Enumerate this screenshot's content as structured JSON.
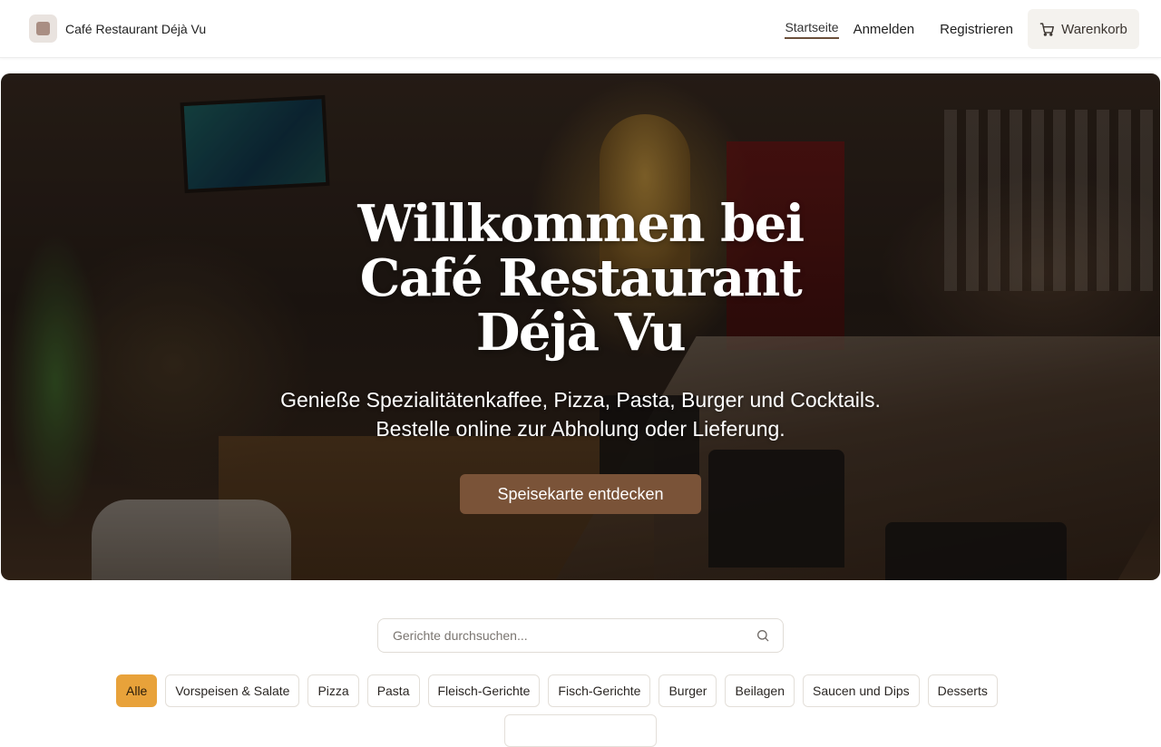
{
  "header": {
    "brand_name": "Café Restaurant Déjà Vu",
    "logo_icon": "logo-square-icon",
    "nav": {
      "home": "Startseite",
      "login": "Anmelden",
      "register": "Registrieren",
      "cart": "Warenkorb",
      "cart_icon": "shopping-cart-icon"
    }
  },
  "hero": {
    "title": "Willkommen bei Café Restaurant Déjà Vu",
    "subtitle_line1": "Genieße Spezialitätenkaffee, Pizza, Pasta, Burger und Cocktails.",
    "subtitle_line2": "Bestelle online zur Abholung oder Lieferung.",
    "cta": "Speisekarte entdecken"
  },
  "search": {
    "placeholder": "Gerichte durchsuchen...",
    "icon": "search-icon"
  },
  "categories": {
    "items": [
      "Alle",
      "Vorspeisen & Salate",
      "Pizza",
      "Pasta",
      "Fleisch-Gerichte",
      "Fisch-Gerichte",
      "Burger",
      "Beilagen",
      "Saucen und Dips",
      "Desserts"
    ],
    "active": "Alle"
  },
  "colors": {
    "accent": "#7a5338",
    "active_chip": "#e8a23a",
    "nav_underline": "#6b4f3a"
  }
}
